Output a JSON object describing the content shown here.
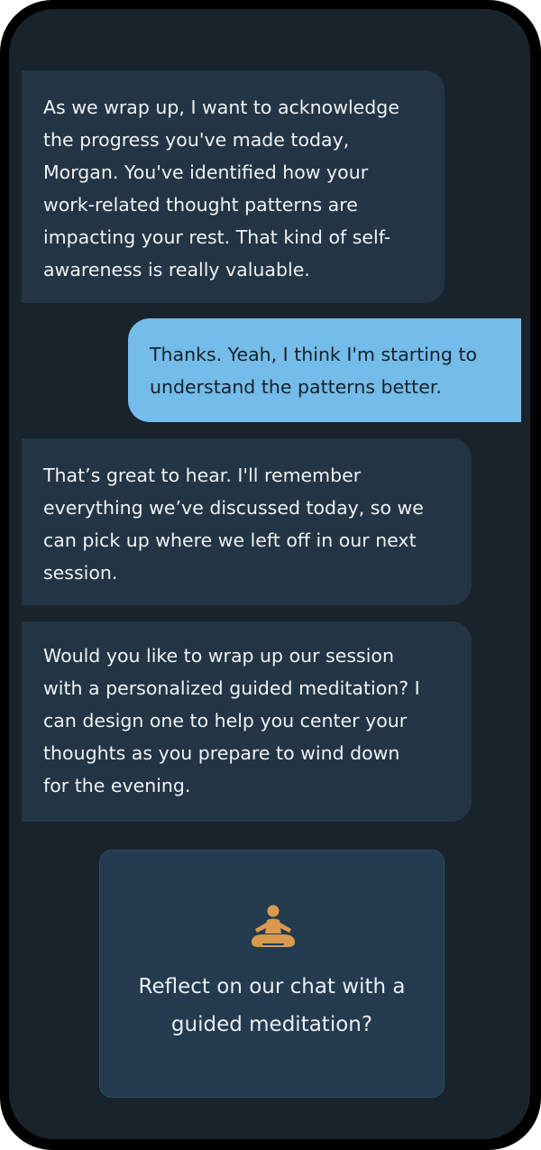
{
  "conversation": {
    "messages": [
      {
        "sender": "assistant",
        "lines": [
          "As we wrap up, I want to acknowledge",
          "the progress you've made today,",
          "Morgan. You've identified how your",
          "work-related thought patterns are",
          "impacting your rest. That kind of self-",
          "awareness is really valuable."
        ]
      },
      {
        "sender": "user",
        "lines": [
          "Thanks. Yeah, I think I'm starting to",
          "understand the patterns better."
        ]
      },
      {
        "sender": "assistant",
        "lines": [
          "That’s great to hear. I'll remember",
          "everything we’ve discussed today, so we",
          "can pick up where we left off in our next",
          "session."
        ]
      },
      {
        "sender": "assistant",
        "lines": [
          "Would you like to wrap up our session",
          "with a personalized guided meditation? I",
          "can design one to help you center your",
          "thoughts as you prepare to wind down",
          "for the evening."
        ]
      }
    ]
  },
  "meditation_card": {
    "icon": "meditation-pose-icon",
    "lines": [
      "Reflect on our chat with a",
      "guided meditation?"
    ]
  },
  "colors": {
    "background": "#19232c",
    "assistant_bubble": "#233444",
    "user_bubble": "#74bce9",
    "card": "#233a4f",
    "icon_accent": "#d99a4e"
  }
}
